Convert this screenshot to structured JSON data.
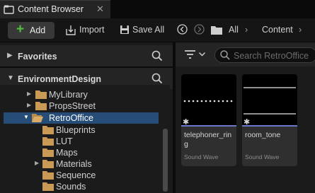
{
  "tab": {
    "title": "Content Browser",
    "icon": "content-browser-icon",
    "close": "✕"
  },
  "toolbar": {
    "add_label": "Add",
    "import_label": "Import",
    "save_all_label": "Save All",
    "breadcrumb": [
      "All",
      "Content"
    ]
  },
  "favorites": {
    "label": "Favorites"
  },
  "project": {
    "label": "EnvironmentDesign"
  },
  "tree": [
    {
      "label": "MyLibrary",
      "expander": "▶"
    },
    {
      "label": "PropsStreet",
      "expander": "▶"
    },
    {
      "label": "RetroOffice",
      "expander": "▼",
      "selected": true
    },
    {
      "label": "Blueprints",
      "expander": ""
    },
    {
      "label": "LUT",
      "expander": ""
    },
    {
      "label": "Maps",
      "expander": ""
    },
    {
      "label": "Materials",
      "expander": "▶"
    },
    {
      "label": "Sequence",
      "expander": ""
    },
    {
      "label": "Sounds",
      "expander": ""
    }
  ],
  "search": {
    "placeholder": "Search RetroOffice"
  },
  "assets": [
    {
      "name": "telephoner_ring",
      "type": "Sound Wave"
    },
    {
      "name": "room_tone",
      "type": "Sound Wave"
    }
  ],
  "colors": {
    "accent_green": "#4fbf3c",
    "selection": "#254d78",
    "folder": "#c89a55",
    "asset_underline": "#6a78c9"
  }
}
